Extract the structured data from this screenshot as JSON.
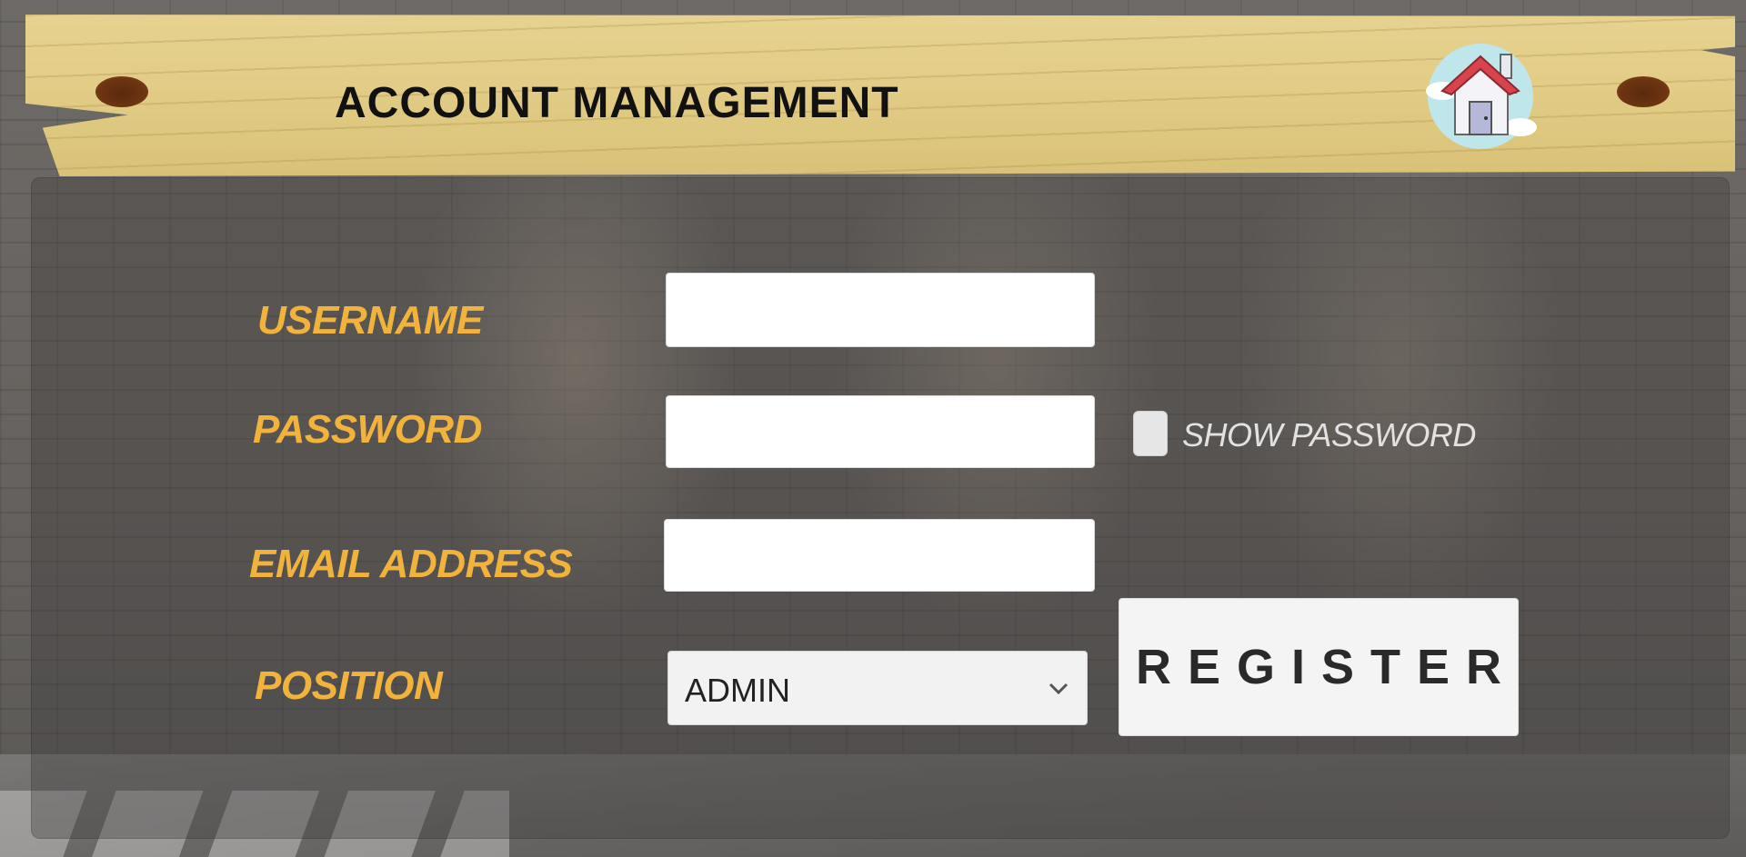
{
  "header": {
    "title": "ACCOUNT MANAGEMENT",
    "home_icon": "home-icon"
  },
  "form": {
    "username_label": "USERNAME",
    "username_value": "",
    "password_label": "PASSWORD",
    "password_value": "",
    "show_password_label": "SHOW PASSWORD",
    "show_password_checked": false,
    "email_label": "EMAIL ADDRESS",
    "email_value": "",
    "position_label": "POSITION",
    "position_selected": "ADMIN",
    "register_label": "REGISTER"
  },
  "colors": {
    "label": "#f2b33d",
    "plank": "#e2cc86",
    "house_roof": "#d9434c"
  }
}
